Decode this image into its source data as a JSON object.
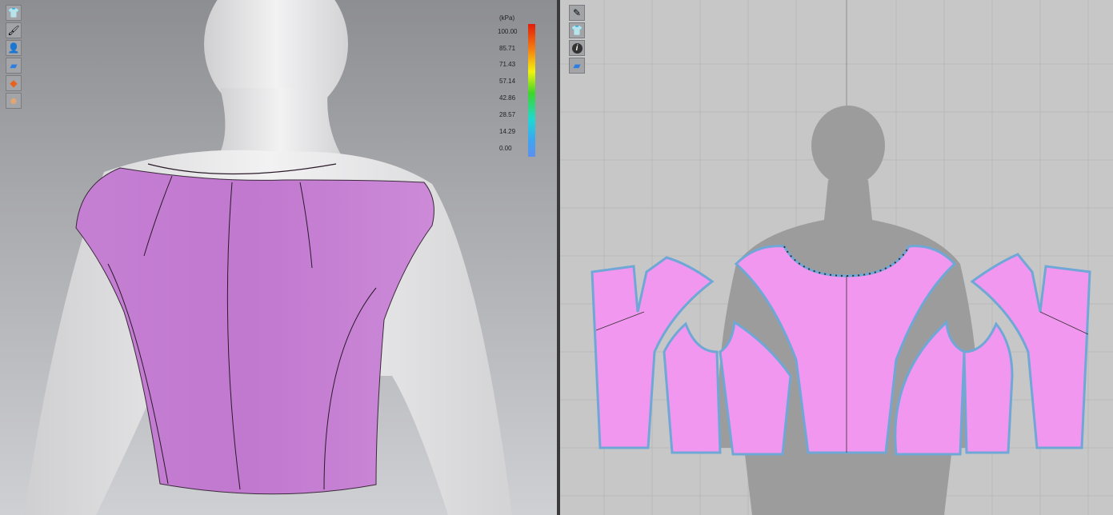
{
  "left_view": {
    "toolbar": [
      {
        "name": "show-avatar-garment",
        "icon": "garment-eye-icon",
        "glyph": "👕"
      },
      {
        "name": "show-fitting",
        "icon": "brush-eye-icon",
        "glyph": "🖌"
      },
      {
        "name": "show-avatar",
        "icon": "avatar-eye-icon",
        "glyph": "👤"
      },
      {
        "name": "texture-view",
        "icon": "texture-icon",
        "glyph": "▰"
      },
      {
        "name": "pressure-map",
        "icon": "pressure-map-icon",
        "glyph": "◆"
      },
      {
        "name": "avatar-skin",
        "icon": "avatar-skin-icon",
        "glyph": "☻"
      }
    ],
    "legend": {
      "unit": "(kPa)",
      "labels": [
        "100.00",
        "85.71",
        "71.43",
        "57.14",
        "42.86",
        "28.57",
        "14.29",
        "0.00"
      ]
    }
  },
  "right_view": {
    "toolbar": [
      {
        "name": "brush",
        "icon": "brush-icon",
        "glyph": "✎"
      },
      {
        "name": "show-garment",
        "icon": "garment-icon",
        "glyph": "👕"
      },
      {
        "name": "info",
        "icon": "info-icon",
        "glyph": "i"
      },
      {
        "name": "texture-view",
        "icon": "texture-icon",
        "glyph": "▰"
      }
    ]
  },
  "colors": {
    "garment": "#d07fd6",
    "pattern": "#f197ef",
    "outline": "#6fa8d6"
  }
}
